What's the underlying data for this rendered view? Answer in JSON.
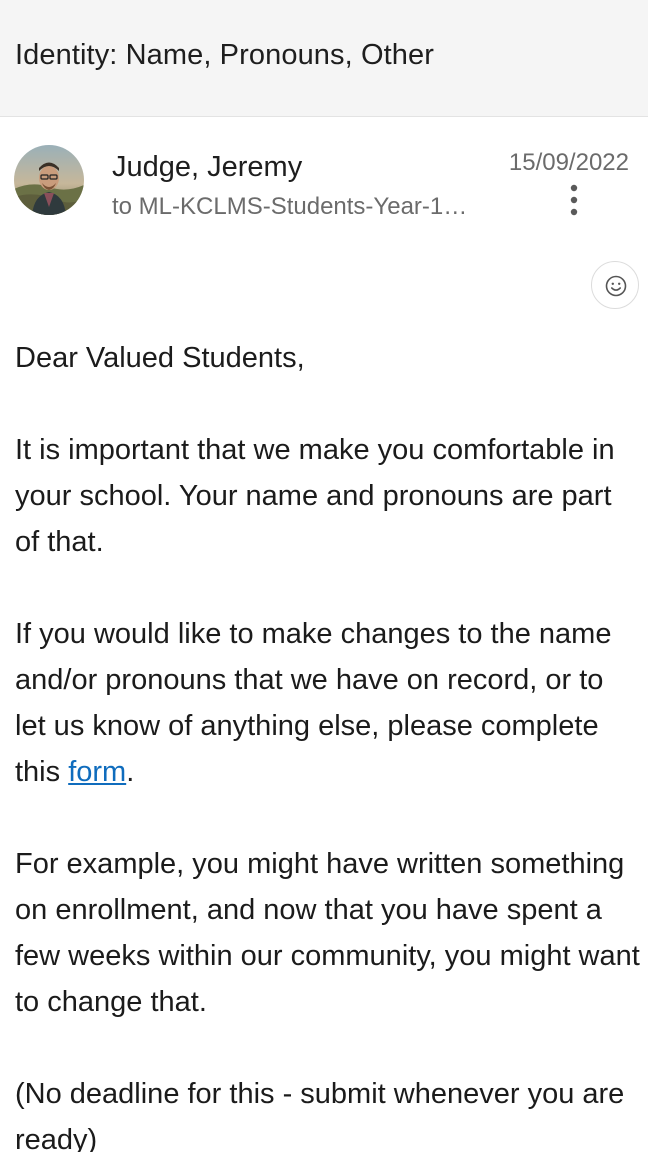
{
  "subject": "Identity: Name, Pronouns, Other",
  "message": {
    "sender": "Judge, Jeremy",
    "recipients": "to ML-KCLMS-Students-Year-1…",
    "date": "15/09/2022"
  },
  "icons": {
    "avatar": "sender-avatar-photo",
    "more": "more-options-vertical-dots-icon",
    "reaction": "smiley-face-icon"
  },
  "body": {
    "greeting": "Dear Valued Students,",
    "paragraph_1": "It is important that we make you comfortable in your school. Your name and pronouns are part of that.",
    "paragraph_2_before_link": "If you would like to make changes to the name and/or pronouns that we have on record, or to let us know of anything else, please complete this ",
    "link_text": "form",
    "paragraph_2_after_link": ".",
    "paragraph_3": "For example, you might have written something on enrollment, and now that you have spent a few weeks within our community, you might want to change that.",
    "paragraph_4": "(No deadline for this - submit whenever you are ready)"
  },
  "colors": {
    "link": "#0f6cbd",
    "header_background": "#f5f5f5",
    "secondary_text": "#6b6b6b"
  }
}
